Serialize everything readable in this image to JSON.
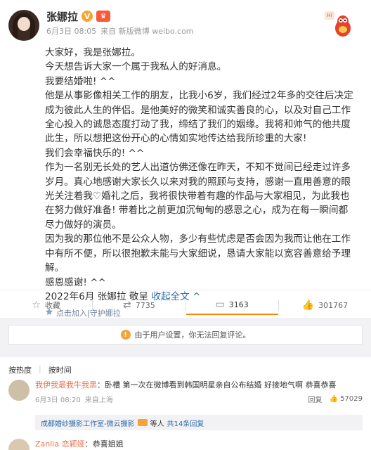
{
  "post": {
    "author": "张娜拉",
    "badge_v": "V",
    "badge_crown": "♛",
    "date": "6月3日 08:05",
    "source": "来自 新版微博 weibo.com",
    "hot_tag": "Hi",
    "paragraphs": [
      "大家好，我是张娜拉。",
      "今天想告诉大家一个属于我私人的好消息。",
      "我要结婚啦! ^^",
      "他是从事影像相关工作的朋友，比我小6岁，我们经过2年多的交往后决定成为彼此人生的伴侣。是他美好的微笑和诚实善良的心，以及对自己工作全心投入的诚恳态度打动了我，缔结了我们的姻缘。我将和帅气的他共度此生，所以想把这份开心的心情如实地传达给我所珍重的大家!",
      "我们会幸福快乐的! ^^",
      "作为一名别无长处的艺人出道仿佛还像在昨天，不知不觉间已经走过许多岁月。真心地感谢大家长久以来对我的照顾与支持，感谢一直用善意的眼光关注着我♡婚礼之后，我将很快带着有趣的作品与大家相见，为此我也在努力做好准备! 带着比之前更加沉甸甸的感恩之心，成为在每一瞬间都尽力做好的演员。",
      "因为我的那位他不是公众人物，多少有些忧虑是否会因为我而让他在工作中有所不便，所以很抱歉未能与大家细说，恳请大家能以宽容善意给予理解。",
      "感恩感谢! ^^"
    ],
    "signature": "2022年6月 张娜拉 敬呈",
    "collapse_label": "收起全文",
    "collapse_caret": "^",
    "fan_label": "点击加入|守护娜拉"
  },
  "actions": {
    "favorite": "收藏",
    "repost": "7735",
    "comment": "3163",
    "like": "301767"
  },
  "notice": "由于用户设置，你无法回复评论。",
  "sort": {
    "hot": "按热度",
    "time": "按时间"
  },
  "comments": [
    {
      "user": "我伊我最我牛我黑",
      "text": "：卧槽 第一次在微博看到韩国明星亲自公布结婚 好接地气啊 恭喜恭喜",
      "time": "6月3日 08:20",
      "location": "来自上海",
      "reply_label": "回复",
      "likes": "57029"
    },
    {
      "user": "Zanlia 恋颖娅",
      "text": "：恭喜姐姐"
    }
  ],
  "reply_preview": {
    "user": "成都婚纱摄影工作室-微云摄影",
    "suffix": "等人",
    "count": "共14条回复"
  },
  "colors": {
    "accent": "#eb7350",
    "link": "#2e6aa8",
    "orange": "#ff8200"
  }
}
